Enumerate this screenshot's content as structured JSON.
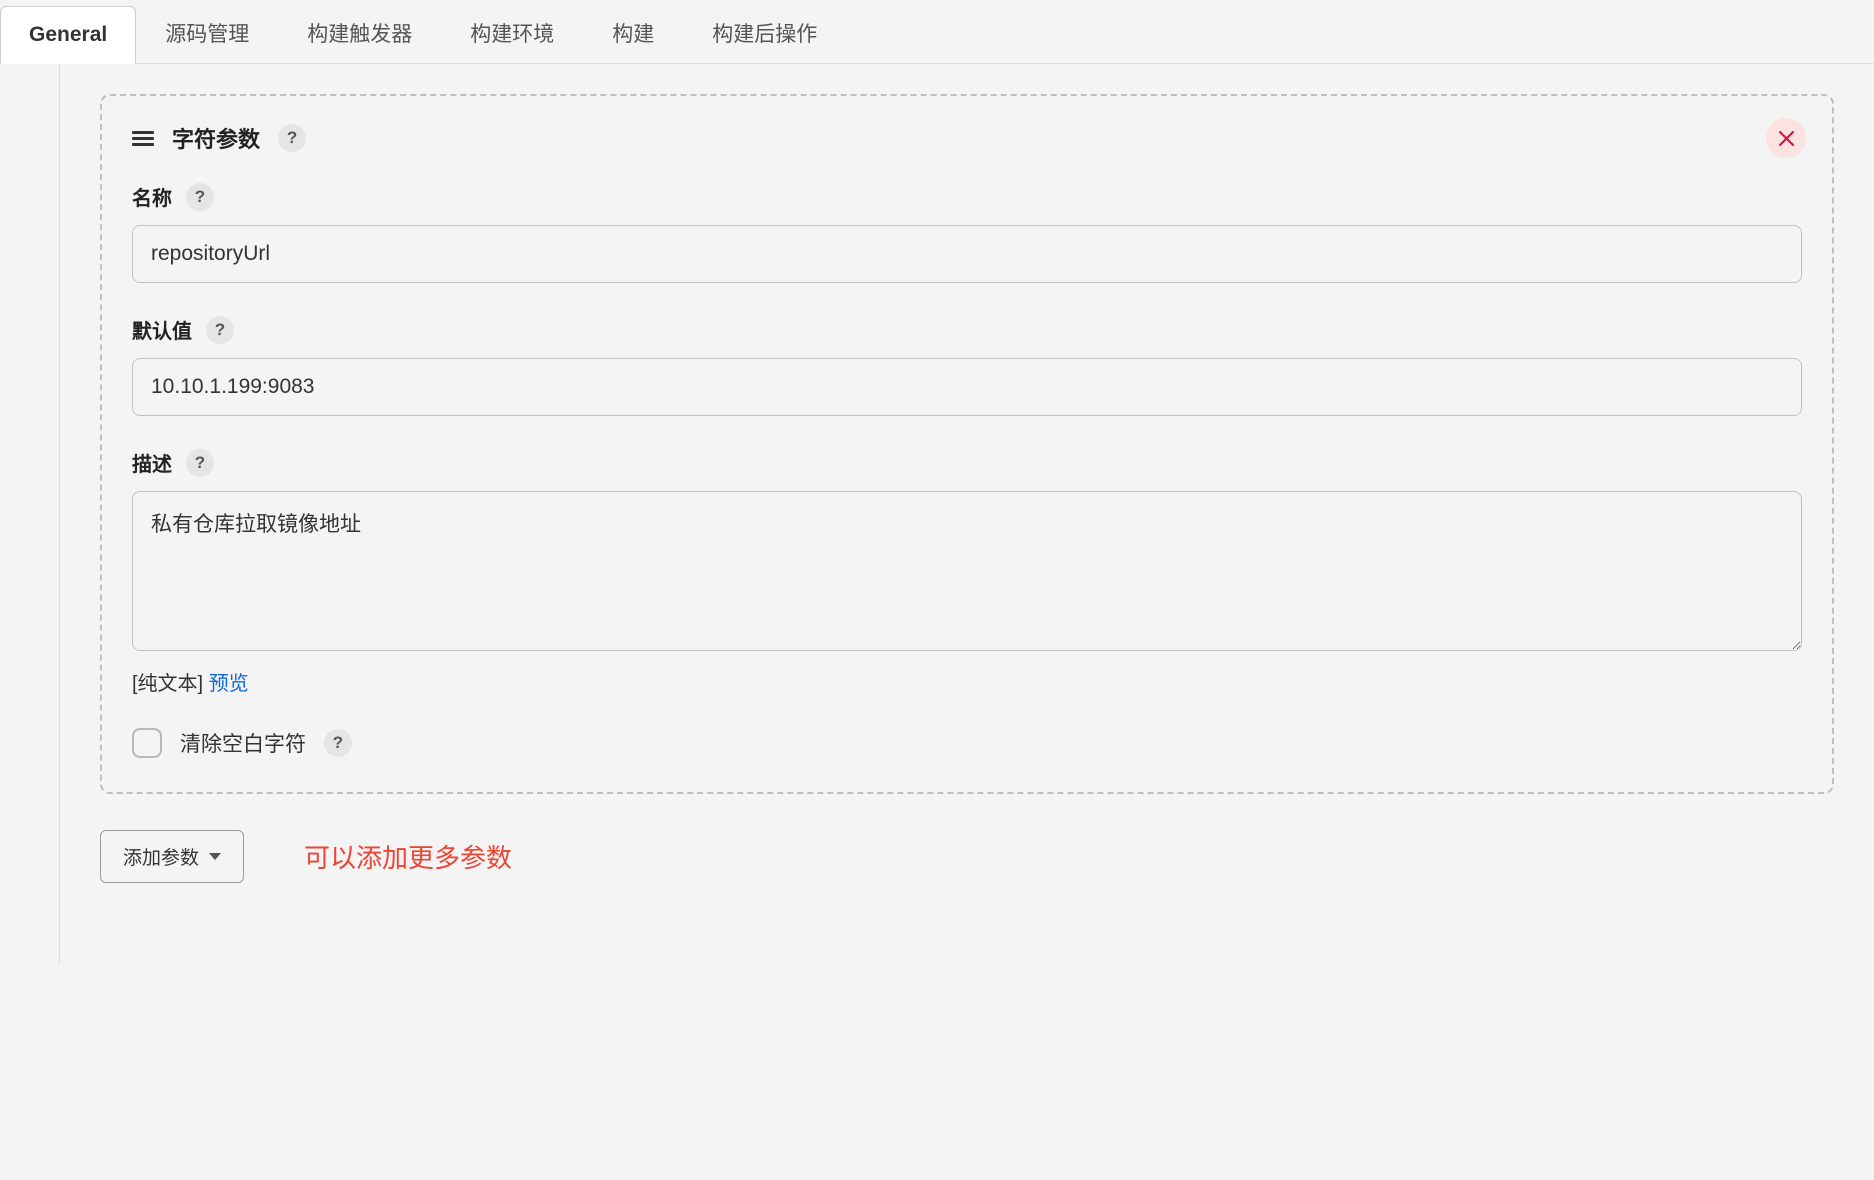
{
  "tabs": {
    "general": "General",
    "source": "源码管理",
    "triggers": "构建触发器",
    "env": "构建环境",
    "build": "构建",
    "postbuild": "构建后操作"
  },
  "param": {
    "type_label": "字符参数",
    "name_label": "名称",
    "name_value": "repositoryUrl",
    "default_label": "默认值",
    "default_value": "10.10.1.199:9083",
    "desc_label": "描述",
    "desc_value": "私有仓库拉取镜像地址",
    "plaintext_hint": "[纯文本]",
    "preview_link": "预览",
    "trim_label": "清除空白字符"
  },
  "help_char": "?",
  "add_button": "添加参数",
  "annotation": "可以添加更多参数"
}
